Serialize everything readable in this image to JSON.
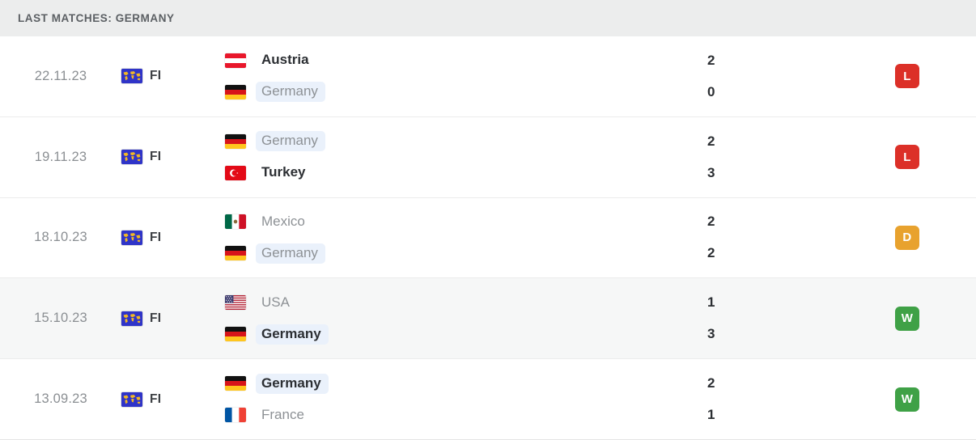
{
  "header": {
    "title": "LAST MATCHES: GERMANY"
  },
  "colors": {
    "result_win": "#3fa146",
    "result_draw": "#e8a22e",
    "result_loss": "#dc3028",
    "highlight_pill": "#eaf1fb",
    "header_bg": "#eceded",
    "row_shaded_bg": "#f6f7f7"
  },
  "competition": {
    "icon": "world-map-icon",
    "label": "FI"
  },
  "matches": [
    {
      "date": "22.11.23",
      "competition": "FI",
      "competition_icon": "world-map-icon",
      "home": {
        "team": "Austria",
        "flag": "austria-flag",
        "score": "2",
        "bold": true,
        "highlight": false
      },
      "away": {
        "team": "Germany",
        "flag": "germany-flag",
        "score": "0",
        "bold": false,
        "highlight": true
      },
      "result": {
        "letter": "L",
        "label": "loss",
        "color": "#dc3028"
      },
      "shaded": false
    },
    {
      "date": "19.11.23",
      "competition": "FI",
      "competition_icon": "world-map-icon",
      "home": {
        "team": "Germany",
        "flag": "germany-flag",
        "score": "2",
        "bold": false,
        "highlight": true
      },
      "away": {
        "team": "Turkey",
        "flag": "turkey-flag",
        "score": "3",
        "bold": true,
        "highlight": false
      },
      "result": {
        "letter": "L",
        "label": "loss",
        "color": "#dc3028"
      },
      "shaded": false
    },
    {
      "date": "18.10.23",
      "competition": "FI",
      "competition_icon": "world-map-icon",
      "home": {
        "team": "Mexico",
        "flag": "mexico-flag",
        "score": "2",
        "bold": false,
        "highlight": false
      },
      "away": {
        "team": "Germany",
        "flag": "germany-flag",
        "score": "2",
        "bold": false,
        "highlight": true
      },
      "result": {
        "letter": "D",
        "label": "draw",
        "color": "#e8a22e"
      },
      "shaded": false
    },
    {
      "date": "15.10.23",
      "competition": "FI",
      "competition_icon": "world-map-icon",
      "home": {
        "team": "USA",
        "flag": "usa-flag",
        "score": "1",
        "bold": false,
        "highlight": false
      },
      "away": {
        "team": "Germany",
        "flag": "germany-flag",
        "score": "3",
        "bold": true,
        "highlight": true
      },
      "result": {
        "letter": "W",
        "label": "win",
        "color": "#3fa146"
      },
      "shaded": true
    },
    {
      "date": "13.09.23",
      "competition": "FI",
      "competition_icon": "world-map-icon",
      "home": {
        "team": "Germany",
        "flag": "germany-flag",
        "score": "2",
        "bold": true,
        "highlight": true
      },
      "away": {
        "team": "France",
        "flag": "france-flag",
        "score": "1",
        "bold": false,
        "highlight": false
      },
      "result": {
        "letter": "W",
        "label": "win",
        "color": "#3fa146"
      },
      "shaded": false
    }
  ]
}
